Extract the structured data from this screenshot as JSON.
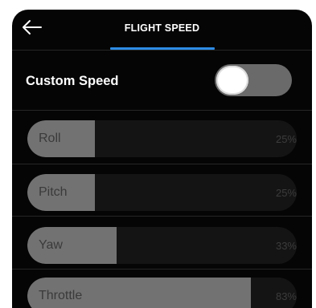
{
  "header": {
    "title": "FLIGHT SPEED",
    "accent_color": "#2d8ce6"
  },
  "custom_speed": {
    "label": "Custom Speed",
    "enabled": false
  },
  "sliders": [
    {
      "label": "Roll",
      "value_text": "25%",
      "fill_fraction": 0.25
    },
    {
      "label": "Pitch",
      "value_text": "25%",
      "fill_fraction": 0.25
    },
    {
      "label": "Yaw",
      "value_text": "33%",
      "fill_fraction": 0.33
    },
    {
      "label": "Throttle",
      "value_text": "83%",
      "fill_fraction": 0.83
    }
  ],
  "icons": {
    "back": "back-arrow-icon"
  }
}
